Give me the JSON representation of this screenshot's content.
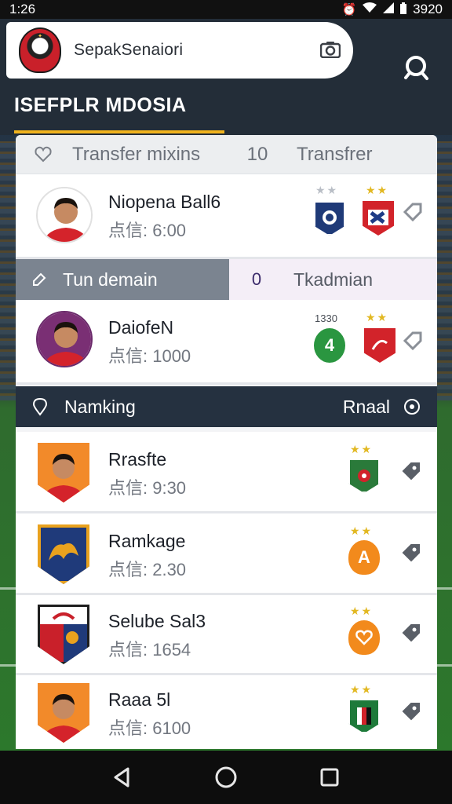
{
  "status_bar": {
    "time": "1:26",
    "battery": "3920"
  },
  "header": {
    "app_title": "SepakSenaiori",
    "section_title": "ISEFPLR MDOSIA"
  },
  "tabs": {
    "left": "Transfer mixins",
    "count": "10",
    "right": "Transfrer"
  },
  "sub_tabs": {
    "left": "Tun demain",
    "count": "0",
    "right": "Tkadmian"
  },
  "ranking": {
    "label": "Namking",
    "right_label": "Rnaal"
  },
  "transfer_players": [
    {
      "name": "Niopena Ball6",
      "value": "点信: 6:00"
    },
    {
      "name": "DaiofeN",
      "value": "点信: 1000",
      "badge_label": "1330",
      "club_badge": "4"
    }
  ],
  "ranking_players": [
    {
      "name": "Rrasfte",
      "value": "点信: 9:30"
    },
    {
      "name": "Ramkage",
      "value": "点信: 2.30",
      "club_badge": "A"
    },
    {
      "name": "Selube Sal3",
      "value": "点信: 1654"
    },
    {
      "name": "Raaa 5l",
      "value": "点信: 6100"
    }
  ],
  "colors": {
    "accent": "#f0b31e",
    "header_bg": "#232d38",
    "star": "#e2b822"
  },
  "icons": [
    "camera-icon",
    "search-icon",
    "heart-icon",
    "edit-icon",
    "pin-icon",
    "tag-icon",
    "back-icon",
    "home-icon",
    "recents-icon"
  ]
}
